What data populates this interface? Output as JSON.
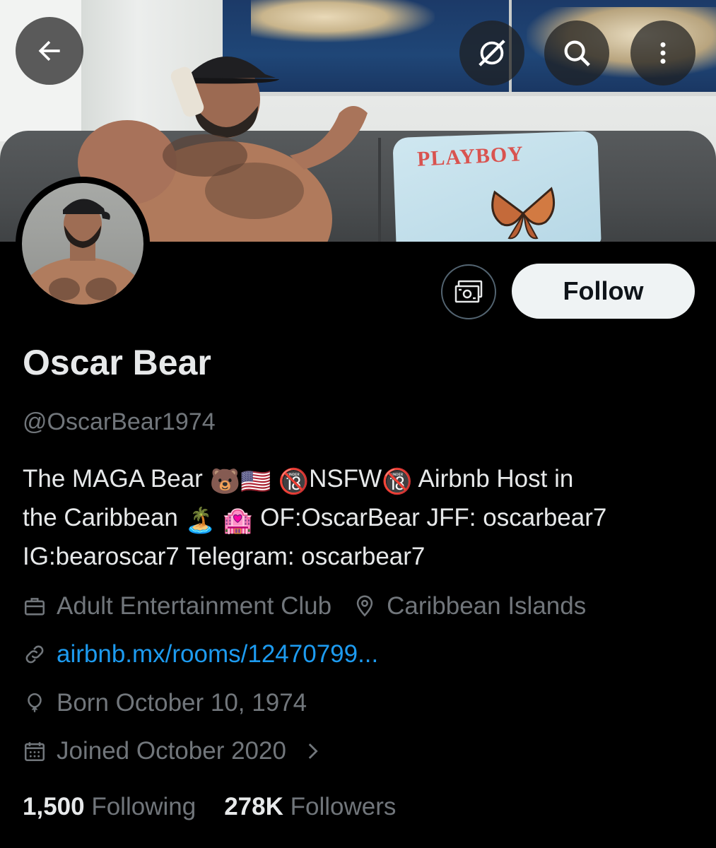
{
  "header": {
    "back_label": "Back",
    "actions": [
      "grok-icon",
      "search-icon",
      "more-icon"
    ]
  },
  "banner": {
    "pillow_text": "PLAYBOY"
  },
  "profile": {
    "display_name": "Oscar Bear",
    "handle": "@OscarBear1974",
    "follow_label": "Follow",
    "bio_lines": [
      [
        "The MAGA Bear ",
        "🐻🇺🇸",
        " ",
        "🔞",
        "NSFW",
        "🔞",
        " Airbnb Host in"
      ],
      [
        "the Caribbean ",
        "🏝️ 🏩",
        " OF:OscarBear JFF: oscarbear7"
      ],
      [
        "IG:bearoscar7 Telegram: oscarbear7"
      ]
    ],
    "bio_text": {
      "line1_a": "The MAGA Bear ",
      "line1_emoji1": "🐻🇺🇸",
      "line1_emoji2": "🔞",
      "line1_b": "NSFW",
      "line1_emoji3": "🔞",
      "line1_c": " Airbnb Host in",
      "line2_a": "the Caribbean ",
      "line2_emoji": "🏝️ 🏩",
      "line2_b": " OF:OscarBear JFF: oscarbear7",
      "line3": "IG:bearoscar7 Telegram: oscarbear7"
    },
    "category": "Adult Entertainment Club",
    "location": "Caribbean Islands",
    "website": "airbnb.mx/rooms/12470799...",
    "birthday": "Born October 10, 1974",
    "joined": "Joined October 2020",
    "following_count": "1,500",
    "following_label": "Following",
    "followers_count": "278K",
    "followers_label": "Followers"
  },
  "colors": {
    "background": "#000000",
    "text_primary": "#e7e9ea",
    "text_secondary": "#71767b",
    "link": "#1d9bf0",
    "follow_button_bg": "#eff3f4"
  }
}
